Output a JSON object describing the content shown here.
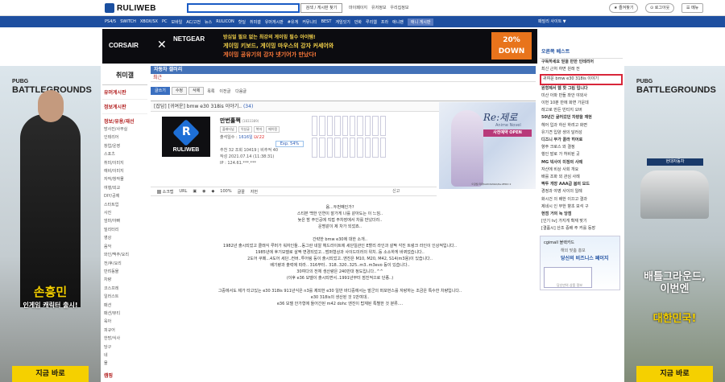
{
  "header": {
    "logo_text": "RULIWEB",
    "search_button": "검색 / 게시판 찾기",
    "top_links": [
      "마이페이지",
      "유저정보",
      "우리집정보"
    ],
    "fav_button": "★ 즐겨찾기",
    "logout_button": "⊙ 로그아웃",
    "menu_button": "☰ 메뉴"
  },
  "nav": {
    "items": [
      "PS4/5",
      "SWITCH",
      "XBOX/SX",
      "PC",
      "모바일",
      "AC/고전",
      "뉴스",
      "RULICON",
      "핫딜",
      "취미갤",
      "유머게시판",
      "#유게",
      "커뮤니티",
      "BEST",
      "게임잇기",
      "만화",
      "루리웹",
      "프라",
      "애니팬",
      "애니 게시판"
    ],
    "site_label": "패밀리 사이트 ▼"
  },
  "ad_banner": {
    "brand1": "CORSAIR",
    "brand2": "NETGEAR",
    "line1": "방심일 필요 없는 최강의 게이밍 필수 아이템!",
    "line2": "게이밍 키보드, 게이밍 마우스의 강자 커세어와",
    "line3": "게이밍 공유기의 강자 넷기어가 만났다!",
    "sale": "20% DOWN"
  },
  "left_banner": {
    "game_small": "PUBG",
    "game_big": "BATTLEGROUNDS",
    "headline": "손흥민",
    "sub": "인게임 캐릭터 출시!",
    "button": "지금 바로"
  },
  "right_banner": {
    "game_small": "PUBG",
    "game_big": "BATTLEGROUNDS",
    "sponsor": "현대자동차",
    "headline1": "배틀그라운드,",
    "headline2": "이번엔",
    "headline3": "대한민국!",
    "button": "지금 바로"
  },
  "left_menu": {
    "title": "취미갤",
    "link1": "유머게시판",
    "link2": "정보게시판",
    "section": "정보/유용/재선",
    "items": [
      "방사진/사무실",
      "인테리어",
      "창업/운영",
      "스포츠",
      "취미/이미지",
      "예비/이미지",
      "자작/창작물",
      "여행/외교",
      "DIY/공예",
      "스타트업",
      "사진",
      "엄마/아빠",
      "밀리터리",
      "영상",
      "음악",
      "와인/맥주/요리",
      "전/후/요리",
      "반려동물",
      "차량",
      "코스프레",
      "일러스트",
      "패션",
      "패션/뷰티",
      "육아",
      "피규어",
      "한방/식사",
      "당구",
      "네",
      "물"
    ],
    "bottom": "캠핑"
  },
  "main": {
    "board_title": "자동차 갤러리",
    "subtitle": "최근",
    "tabs": [
      "글쓰기",
      "수정",
      "삭제"
    ],
    "tab_links": [
      "목록",
      "이전글",
      "다음글"
    ],
    "post_category": "[잡담]",
    "post_title": "[귀여운] bmw e30 318is 이야기..",
    "comment_count": "(34)",
    "author": {
      "avatar_text": "RULIWEB",
      "nick": "만번훌쩍",
      "uid": "(1833389)",
      "badges": [
        "플래티넘",
        "악성글",
        "북마",
        "메이킹"
      ],
      "level_label": "출석일수 :",
      "days": "1616일",
      "level": "LV.22",
      "exp": "Exp. 54%",
      "stats": "추천 32  조회 10419 | 비추적 40",
      "date": "작성 2021.07.14 (11:38:31)",
      "ip": "IP : 124.61.***.***"
    },
    "novel_ad": {
      "title": "Re:제로",
      "subtitle": "Anime Novel",
      "cta": "사전예약 OPEN",
      "caption": "©장월 타파KADOKAWA/Re:ZERO 2"
    },
    "actions": [
      "소크랩",
      "URL",
      "100%",
      "글꼴",
      "자헌"
    ],
    "report": "신고",
    "body_lines": [
      "음...두번째인가?",
      "스티븐 백한 인연이 잘가게 나를 같아도는 이 느낌..",
      "늦은 밤 주인공에 직접 주차장에서 차를 만났더라..",
      "운명같이 제 차가 되었죠..",
      "",
      "간략한 bmw e30에 대한 소개..",
      "1982년 출시되었고 클래식 루머가 워자인들...동그란 네알 헤드라이트에 세단일관인 E할리 라인과 살짝 각진 트렁크 라인이 인상적입니다..",
      "1985년에 후기모델로 살짝 변경되었고...범퍼형상과 사이드미러의 위치..등 소소하게 바뀌었습니다..",
      "2도어 쿠페...4도어 세단..컨버..투어링 등이 출시되었고..엔진은 M10, M20, M42, S14(m3용)이 있습니다..",
      "배기량과 출력에 따라.. 316부터.. 318..320..325..m3..m3evo 등이 있습니다..",
      "30여다의 전체 생산량은 240만대 정도입니다..^^",
      "(이후 e36 모델이 출시되면서..1991년부터 점진적으로 단종..)",
      "",
      "그중에서도 제가 타고있는 e30 318is 911년식은 n3를 제외한 e30 일반 바디중에서는 발군의 퍼포먼스를 자랑하는 조금은 특수한 차량입니다..",
      "e30 318is의 생산된 것 1만여대..",
      "e36 모델 안가형에 들어간된 m42 dohc 엔진이 탑재된 특별한 것 분류...."
    ]
  },
  "right_col": {
    "header": "오른쪽 베스트",
    "items": [
      "구독하세요 믿을 만한 인테리어",
      "최신 근처 하면 원래 전",
      "귀여운 bmw e30 318is 이야기",
      "원형제서 웹 핫 그림 입니다",
      "미산 아파 반들 좌안 야외사",
      "이번 10분 만에 화면 가운데",
      "레고로 만든 빈티지 오버",
      "50년간 굴러갔던 차량을 재현",
      "헤어 입과 하산 하려고 화면",
      "유기견 입양 생의 달러성",
      "디즈니 무가 콜라 히어로",
      "향주 크로스 와 결정",
      "행인 발로 가 허비된 곳",
      "MG 빅사이 미정의 사례",
      "자산에 비상 사회 개요",
      "배를 조화 외 관심 사례",
      "짝투 개장 AAA급 봄의 모드",
      "경정과 야영 사이의 일례",
      "화시건 의 배한 이끄고 결과",
      "제네시 인 부한 향초 보석 구",
      "현점 거의 녹 당점",
      "[인기 tv] 가지게 확재 맞기",
      "[결품시] 산조 증배 주 커를 등장"
    ],
    "ad_line1": "당신의 비즈니스 페이지",
    "ad_line2": "해외 맞춤 홍보",
    "ad_brand": "cgimall 블랙카드",
    "ad_foot": "당신만의 상품 정보"
  }
}
